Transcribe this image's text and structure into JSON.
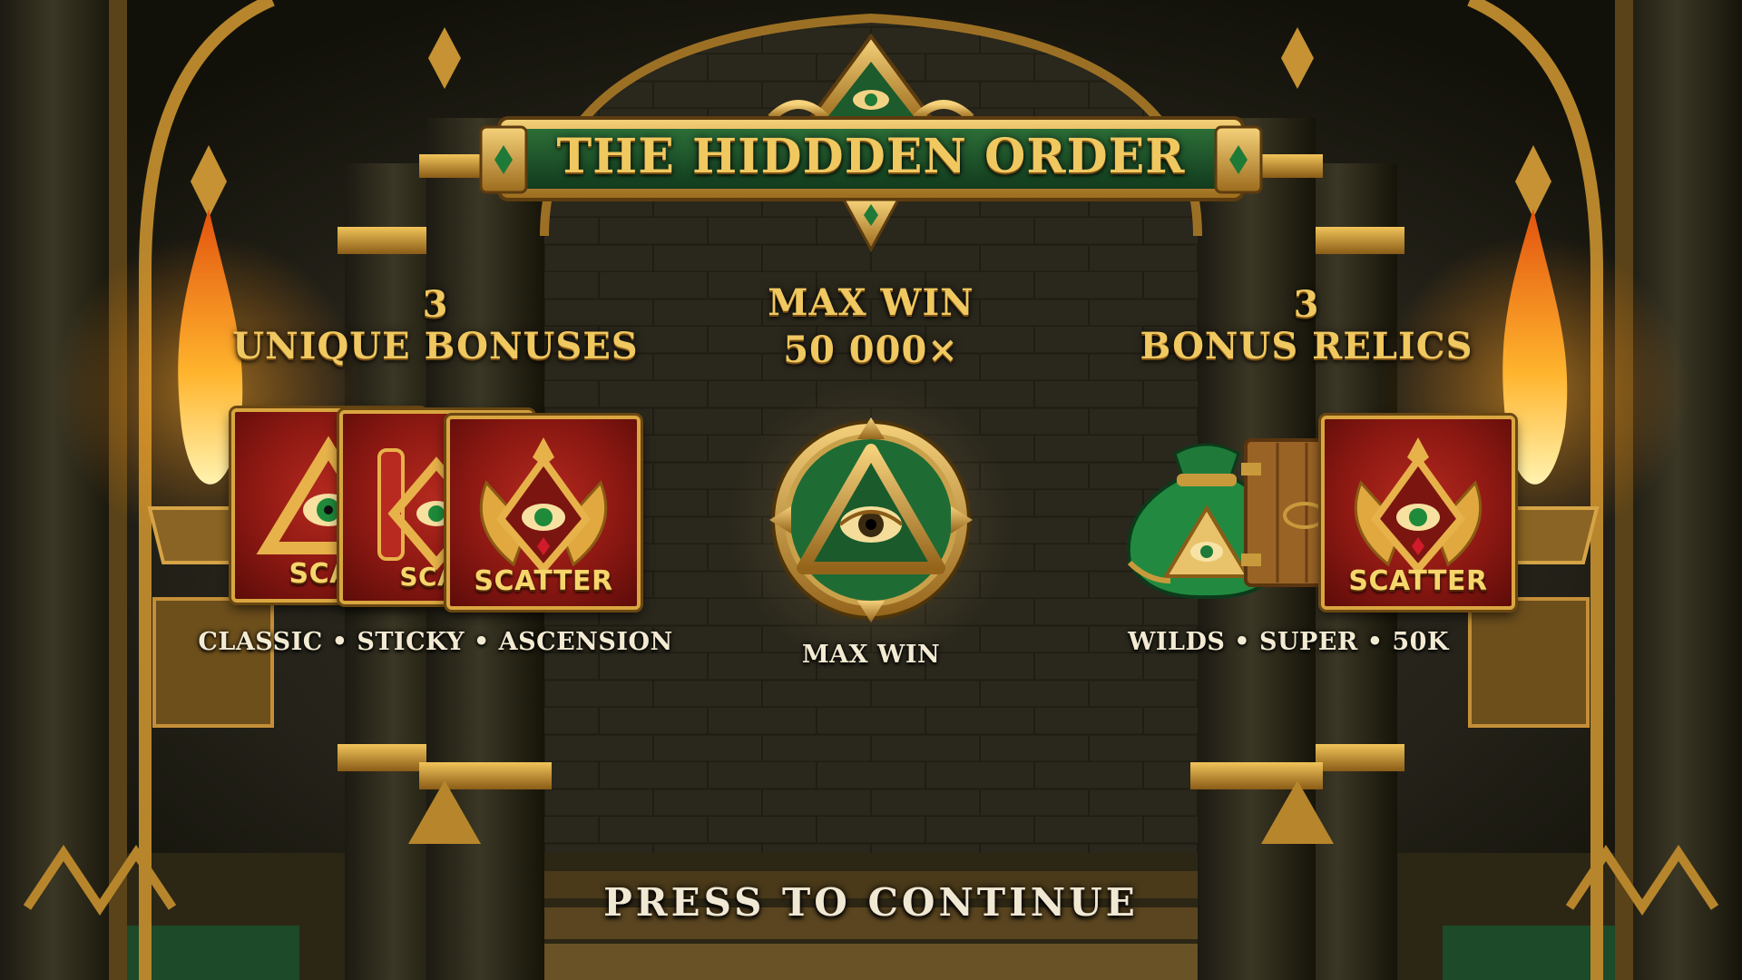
{
  "title": "THE HIDDDEN ORDER",
  "left_panel": {
    "count": "3",
    "heading": "UNIQUE BONUSES",
    "card_label": "SCATTER",
    "card_label_partial_1": "SCAT",
    "card_label_partial_2": "SCAT",
    "caption": "CLASSIC • STICKY • ASCENSION"
  },
  "center_panel": {
    "heading_line1": "MAX WIN",
    "heading_line2": "50 000×",
    "caption": "MAX WIN",
    "icon": "all-seeing-eye-medallion-icon"
  },
  "right_panel": {
    "count": "3",
    "heading": "BONUS RELICS",
    "card_label": "SCATTER",
    "caption": "WILDS • SUPER • 50K",
    "icons": [
      "money-bag-icon",
      "wooden-door-icon",
      "scatter-icon"
    ]
  },
  "continue_label": "PRESS TO CONTINUE",
  "colors": {
    "gold": "#f0c860",
    "scatter_red": "#8c1812",
    "emerald": "#1f6b34",
    "stone": "#2b291f"
  }
}
